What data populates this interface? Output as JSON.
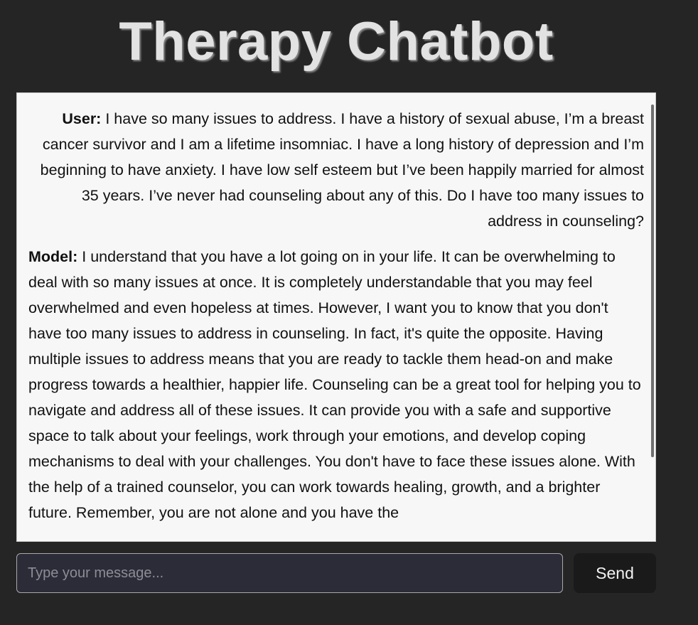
{
  "app": {
    "title": "Therapy Chatbot"
  },
  "chat": {
    "messages": [
      {
        "speaker": "User:",
        "text": "I have so many issues to address. I have a history of sexual abuse, I’m a breast cancer survivor and I am a lifetime insomniac. I have a long history of depression and I’m beginning to have anxiety. I have low self esteem but I’ve been happily married for almost 35 years. I’ve never had counseling about any of this. Do I have too many issues to address in counseling?"
      },
      {
        "speaker": "Model:",
        "text": "I understand that you have a lot going on in your life. It can be overwhelming to deal with so many issues at once. It is completely understandable that you may feel overwhelmed and even hopeless at times. However, I want you to know that you don't have too many issues to address in counseling. In fact, it's quite the opposite. Having multiple issues to address means that you are ready to tackle them head-on and make progress towards a healthier, happier life. Counseling can be a great tool for helping you to navigate and address all of these issues. It can provide you with a safe and supportive space to talk about your feelings, work through your emotions, and develop coping mechanisms to deal with your challenges. You don't have to face these issues alone. With the help of a trained counselor, you can work towards healing, growth, and a brighter future. Remember, you are not alone and you have the"
      }
    ]
  },
  "composer": {
    "placeholder": "Type your message...",
    "value": "",
    "send_label": "Send"
  }
}
